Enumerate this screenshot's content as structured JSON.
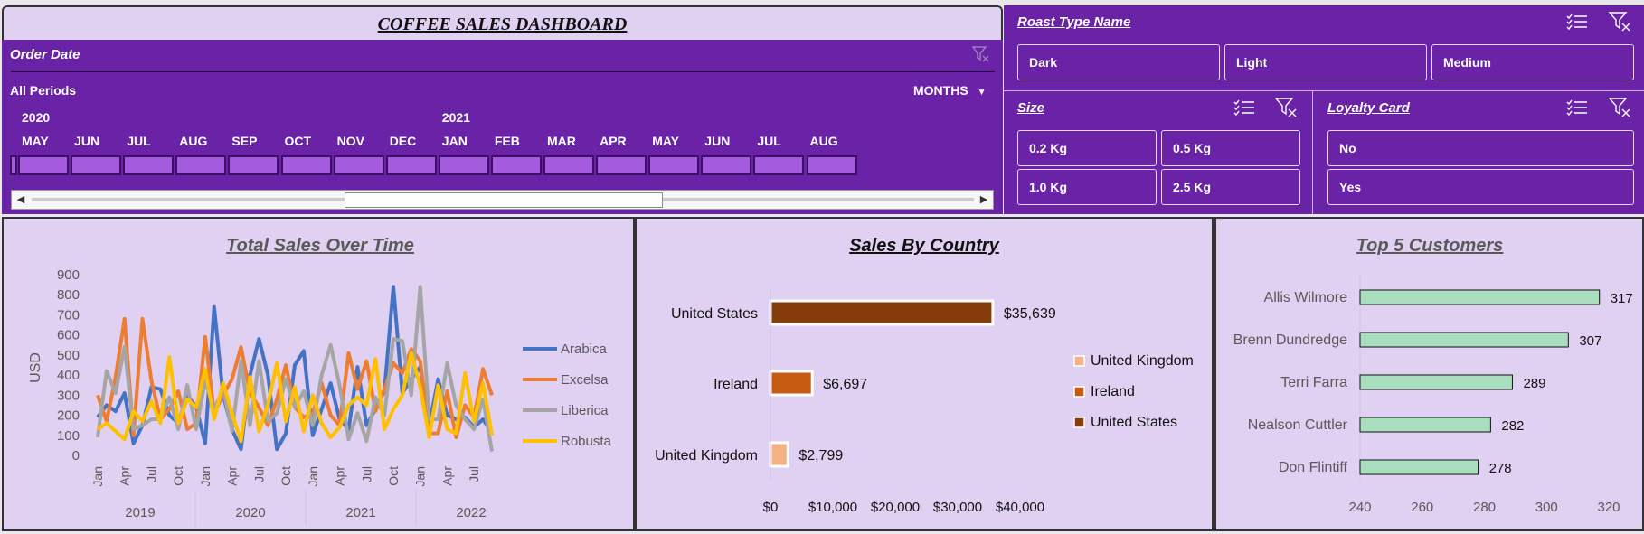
{
  "dashboard_title": "COFFEE SALES DASHBOARD",
  "timeline": {
    "header": "Order Date",
    "period_label": "All Periods",
    "level_label": "MONTHS",
    "years": [
      {
        "label": "2020",
        "col": 0
      },
      {
        "label": "2021",
        "col": 8
      }
    ],
    "months": [
      "MAY",
      "JUN",
      "JUL",
      "AUG",
      "SEP",
      "OCT",
      "NOV",
      "DEC",
      "JAN",
      "FEB",
      "MAR",
      "APR",
      "MAY",
      "JUN",
      "JUL",
      "AUG"
    ]
  },
  "slicers": {
    "roast": {
      "title": "Roast Type Name",
      "items": [
        "Dark",
        "Light",
        "Medium"
      ]
    },
    "size": {
      "title": "Size",
      "items": [
        "0.2 Kg",
        "0.5 Kg",
        "1.0 Kg",
        "2.5 Kg"
      ]
    },
    "loyalty": {
      "title": "Loyalty Card",
      "items": [
        "No",
        "Yes"
      ]
    }
  },
  "colors": {
    "purple": "#6a22a7",
    "panel": "#e0d0f2",
    "arabica": "#4472c4",
    "excelsa": "#ed7d31",
    "liberica": "#a5a5a5",
    "robusta": "#ffc000",
    "us": "#843c0c",
    "ireland": "#c55a11",
    "uk": "#f4b183",
    "customer_bar": "#a9dfbf"
  },
  "chart_data": [
    {
      "type": "line",
      "title": "Total Sales Over Time",
      "ylabel": "USD",
      "ylim": [
        0,
        900
      ],
      "yticks": [
        0,
        100,
        200,
        300,
        400,
        500,
        600,
        700,
        800,
        900
      ],
      "month_ticks": [
        "Jan",
        "Apr",
        "Jul",
        "Oct",
        "Jan",
        "Apr",
        "Jul",
        "Oct",
        "Jan",
        "Apr",
        "Jul",
        "Oct",
        "Jan",
        "Apr",
        "Jul"
      ],
      "years": [
        "2019",
        "2020",
        "2021",
        "2022"
      ],
      "series": [
        {
          "name": "Arabica",
          "color": "#4472c4",
          "values": [
            190,
            250,
            220,
            310,
            60,
            150,
            340,
            330,
            200,
            160,
            300,
            240,
            60,
            740,
            300,
            130,
            30,
            400,
            580,
            400,
            30,
            110,
            450,
            520,
            100,
            230,
            360,
            180,
            130,
            440,
            150,
            230,
            320,
            840,
            310,
            380,
            440,
            150,
            380,
            200,
            180,
            190,
            140,
            180,
            110
          ]
        },
        {
          "name": "Excelsa",
          "color": "#ed7d31",
          "values": [
            300,
            170,
            390,
            680,
            100,
            680,
            370,
            180,
            230,
            320,
            130,
            160,
            590,
            210,
            300,
            380,
            540,
            310,
            240,
            150,
            280,
            450,
            240,
            190,
            210,
            360,
            200,
            150,
            510,
            330,
            470,
            220,
            330,
            460,
            410,
            530,
            470,
            110,
            110,
            320,
            90,
            250,
            190,
            430,
            300
          ]
        },
        {
          "name": "Liberica",
          "color": "#a5a5a5",
          "values": [
            90,
            420,
            310,
            540,
            130,
            150,
            180,
            180,
            290,
            130,
            350,
            130,
            370,
            230,
            330,
            120,
            470,
            150,
            470,
            170,
            210,
            380,
            240,
            320,
            150,
            400,
            550,
            350,
            80,
            210,
            70,
            290,
            200,
            580,
            570,
            300,
            840,
            180,
            180,
            460,
            250,
            180,
            130,
            280,
            20
          ]
        },
        {
          "name": "Robusta",
          "color": "#ffc000",
          "values": [
            130,
            160,
            120,
            80,
            220,
            170,
            270,
            160,
            490,
            160,
            280,
            240,
            430,
            180,
            360,
            210,
            70,
            390,
            120,
            250,
            460,
            170,
            340,
            120,
            300,
            160,
            90,
            140,
            250,
            290,
            250,
            480,
            130,
            230,
            300,
            510,
            340,
            90,
            350,
            130,
            110,
            410,
            170,
            360,
            100
          ]
        }
      ]
    },
    {
      "type": "bar",
      "title": "Sales By Country",
      "categories": [
        "United States",
        "Ireland",
        "United Kingdom"
      ],
      "values": [
        35639,
        6697,
        2799
      ],
      "value_labels": [
        "$35,639",
        "$6,697",
        "$2,799"
      ],
      "colors": [
        "#843c0c",
        "#c55a11",
        "#f4b183"
      ],
      "xlim": [
        0,
        40000
      ],
      "xticks": [
        "$0",
        "$10,000",
        "$20,000",
        "$30,000",
        "$40,000"
      ],
      "legend": [
        "United Kingdom",
        "Ireland",
        "United States"
      ],
      "legend_colors": [
        "#f4b183",
        "#c55a11",
        "#843c0c"
      ]
    },
    {
      "type": "bar",
      "title": "Top 5 Customers",
      "categories": [
        "Allis Wilmore",
        "Brenn Dundredge",
        "Terri Farra",
        "Nealson Cuttler",
        "Don Flintiff"
      ],
      "values": [
        317,
        307,
        289,
        282,
        278
      ],
      "xlim": [
        240,
        320
      ],
      "xticks": [
        "240",
        "260",
        "280",
        "300",
        "320"
      ]
    }
  ]
}
